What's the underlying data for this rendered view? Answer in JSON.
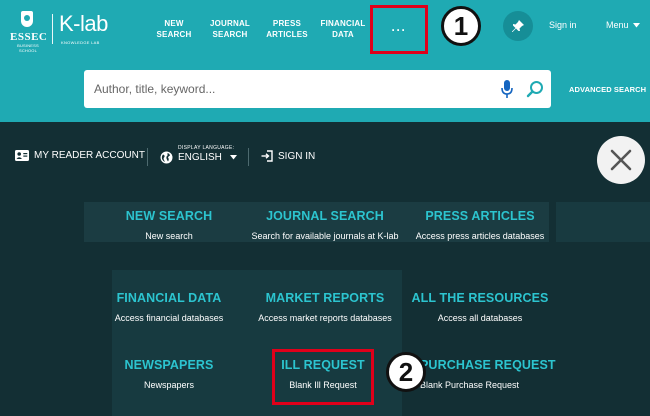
{
  "brand": {
    "essec_name": "ESSEC",
    "essec_sub": "BUSINESS SCHOOL",
    "klab_name": "K-lab",
    "klab_sub": "KNOWLEDGE LAB"
  },
  "topnav": {
    "new_search": [
      "NEW",
      "SEARCH"
    ],
    "journal_search": [
      "JOURNAL",
      "SEARCH"
    ],
    "press_articles": [
      "PRESS",
      "ARTICLES"
    ],
    "financial_data": [
      "FINANCIAL",
      "DATA"
    ],
    "more_label": "···",
    "sign_in": "Sign in",
    "menu": "Menu"
  },
  "search": {
    "placeholder": "Author, title, keyword...",
    "value": "",
    "advanced_label": "ADVANCED SEARCH"
  },
  "utility": {
    "account_label": "MY READER ACCOUNT",
    "language_label": "DISPLAY LANGUAGE:",
    "language_value": "ENGLISH",
    "sign_in_label": "SIGN IN"
  },
  "menu_items": [
    {
      "title": "NEW SEARCH",
      "desc": "New search"
    },
    {
      "title": "JOURNAL SEARCH",
      "desc": "Search for available journals at K-lab"
    },
    {
      "title": "PRESS ARTICLES",
      "desc": "Access press articles databases"
    },
    {
      "title": "FINANCIAL DATA",
      "desc": "Access financial databases"
    },
    {
      "title": "MARKET REPORTS",
      "desc": "Access market reports databases"
    },
    {
      "title": "ALL THE RESOURCES",
      "desc": "Access all databases"
    },
    {
      "title": "NEWSPAPERS",
      "desc": "Newspapers"
    },
    {
      "title": "ILL REQUEST",
      "desc": "Blank Ill Request"
    },
    {
      "title": "PURCHASE REQUEST",
      "desc": "Blank Purchase Request"
    }
  ],
  "callouts": {
    "first": "1",
    "second": "2"
  },
  "colors": {
    "header_teal": "#1faab3",
    "overlay_dark": "#132f34",
    "menu_title": "#2cc4cf",
    "highlight_red": "#e0001a",
    "mic_blue": "#1565c0"
  },
  "icons": [
    "id-card-icon",
    "globe-icon",
    "caret-down-icon",
    "sign-in-icon",
    "close-icon",
    "microphone-icon",
    "search-icon",
    "pin-icon"
  ]
}
